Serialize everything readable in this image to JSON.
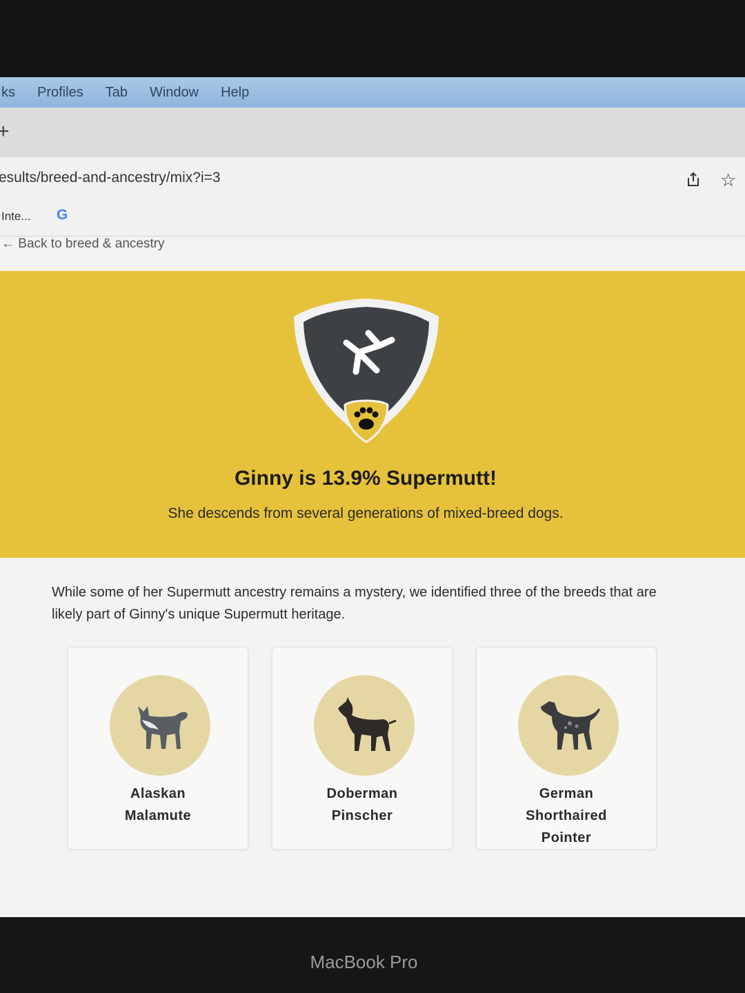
{
  "menubar": {
    "items": [
      "ks",
      "Profiles",
      "Tab",
      "Window",
      "Help"
    ]
  },
  "tabstrip": {
    "new_tab": "+"
  },
  "address": {
    "url": "esults/breed-and-ancestry/mix?i=3"
  },
  "bookmarks": {
    "item": "Inte...",
    "google": "G"
  },
  "page": {
    "back_link": "← Back to breed & ancestry",
    "hero": {
      "title": "Ginny is 13.9% Supermutt!",
      "subtitle": "She descends from several generations of mixed-breed dogs."
    },
    "intro": "While some of her Supermutt ancestry remains a mystery, we identified three of the breeds that are likely part of Ginny's unique Supermutt heritage.",
    "breeds": [
      {
        "line1": "Alaskan",
        "line2": "Malamute",
        "line3": ""
      },
      {
        "line1": "Doberman",
        "line2": "Pinscher",
        "line3": ""
      },
      {
        "line1": "German",
        "line2": "Shorthaired",
        "line3": "Pointer"
      }
    ]
  },
  "device": {
    "brand": "MacBook Pro"
  },
  "colors": {
    "hero_yellow": "#e6c23c",
    "badge_dark": "#3d4146",
    "circle_tan": "#e5d7a4",
    "menubar_blue": "#a9c8e8"
  },
  "icons": [
    "share-icon",
    "star-icon",
    "google-icon",
    "shield-badge-icon",
    "paw-icon"
  ]
}
